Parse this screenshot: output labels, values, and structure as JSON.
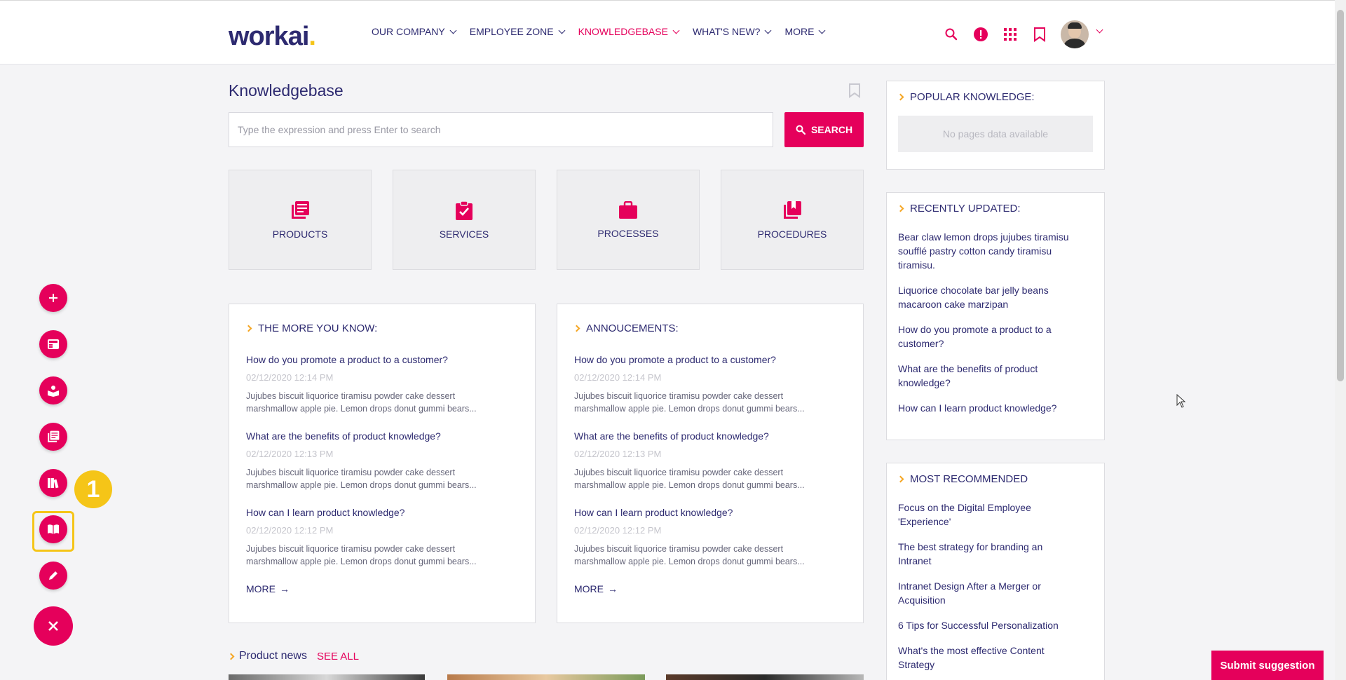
{
  "header": {
    "logo": "workai",
    "logo_dot": ".",
    "nav": [
      {
        "label": "OUR COMPANY",
        "active": false
      },
      {
        "label": "EMPLOYEE ZONE",
        "active": false
      },
      {
        "label": "KNOWLEDGEBASE",
        "active": true
      },
      {
        "label": "WHAT'S NEW?",
        "active": false
      },
      {
        "label": "MORE",
        "active": false
      }
    ]
  },
  "colors": {
    "accent": "#e5005b",
    "navy": "#2d2a70",
    "highlight": "#f5c518"
  },
  "main": {
    "title": "Knowledgebase",
    "search_placeholder": "Type the expression and press Enter to search",
    "search_label": "SEARCH",
    "tiles": [
      {
        "label": "PRODUCTS",
        "icon": "library-books-icon"
      },
      {
        "label": "SERVICES",
        "icon": "clipboard-check-icon"
      },
      {
        "label": "PROCESSES",
        "icon": "briefcase-icon"
      },
      {
        "label": "PROCEDURES",
        "icon": "bookmarks-stack-icon"
      }
    ],
    "more_you_know": {
      "title": "THE MORE YOU KNOW:",
      "articles": [
        {
          "title": "How do you promote a product to a customer?",
          "date": "02/12/2020 12:14 PM",
          "excerpt1": "Jujubes biscuit liquorice tiramisu powder cake dessert",
          "excerpt2": "marshmallow apple pie. Lemon drops donut gummi bears..."
        },
        {
          "title": "What are the benefits of product knowledge?",
          "date": "02/12/2020 12:13 PM",
          "excerpt1": "Jujubes biscuit liquorice tiramisu powder cake dessert",
          "excerpt2": "marshmallow apple pie. Lemon drops donut gummi bears..."
        },
        {
          "title": "How can I learn product knowledge?",
          "date": "02/12/2020 12:12 PM",
          "excerpt1": "Jujubes biscuit liquorice tiramisu powder cake dessert",
          "excerpt2": "marshmallow apple pie. Lemon drops donut gummi bears..."
        }
      ],
      "more": "MORE"
    },
    "announcements": {
      "title": "ANNOUCEMENTS:",
      "articles": [
        {
          "title": "How do you promote a product to a customer?",
          "date": "02/12/2020 12:14 PM",
          "excerpt1": "Jujubes biscuit liquorice tiramisu powder cake dessert",
          "excerpt2": "marshmallow apple pie. Lemon drops donut gummi bears..."
        },
        {
          "title": "What are the benefits of product knowledge?",
          "date": "02/12/2020 12:13 PM",
          "excerpt1": "Jujubes biscuit liquorice tiramisu powder cake dessert",
          "excerpt2": "marshmallow apple pie. Lemon drops donut gummi bears..."
        },
        {
          "title": "How can I learn product knowledge?",
          "date": "02/12/2020 12:12 PM",
          "excerpt1": "Jujubes biscuit liquorice tiramisu powder cake dessert",
          "excerpt2": "marshmallow apple pie. Lemon drops donut gummi bears..."
        }
      ],
      "more": "MORE"
    },
    "product_news": {
      "title": "Product news",
      "see_all": "SEE ALL"
    }
  },
  "sidebar": {
    "popular": {
      "title": "POPULAR KNOWLEDGE:",
      "empty": "No pages data available"
    },
    "recent": {
      "title": "RECENTLY UPDATED:",
      "items": [
        [
          "Bear claw lemon drops jujubes tiramisu",
          "soufflé pastry cotton candy tiramisu",
          "tiramisu."
        ],
        [
          "Liquorice chocolate bar jelly beans",
          "macaroon cake marzipan"
        ],
        [
          "How do you promote a product to a",
          "customer?"
        ],
        [
          "What are the benefits of product",
          "knowledge?"
        ],
        [
          "How can I learn product knowledge?"
        ]
      ]
    },
    "recommended": {
      "title": "MOST RECOMMENDED",
      "items": [
        [
          "Focus on the Digital Employee",
          "'Experience'"
        ],
        [
          "The best strategy for branding an",
          "Intranet"
        ],
        [
          "Intranet Design After a Merger or",
          "Acquisition"
        ],
        [
          "6 Tips for Successful Personalization"
        ],
        [
          "What's the most effective Content",
          "Strategy"
        ]
      ]
    }
  },
  "fab": {
    "step_number": "1"
  },
  "submit_label": "Submit suggestion"
}
